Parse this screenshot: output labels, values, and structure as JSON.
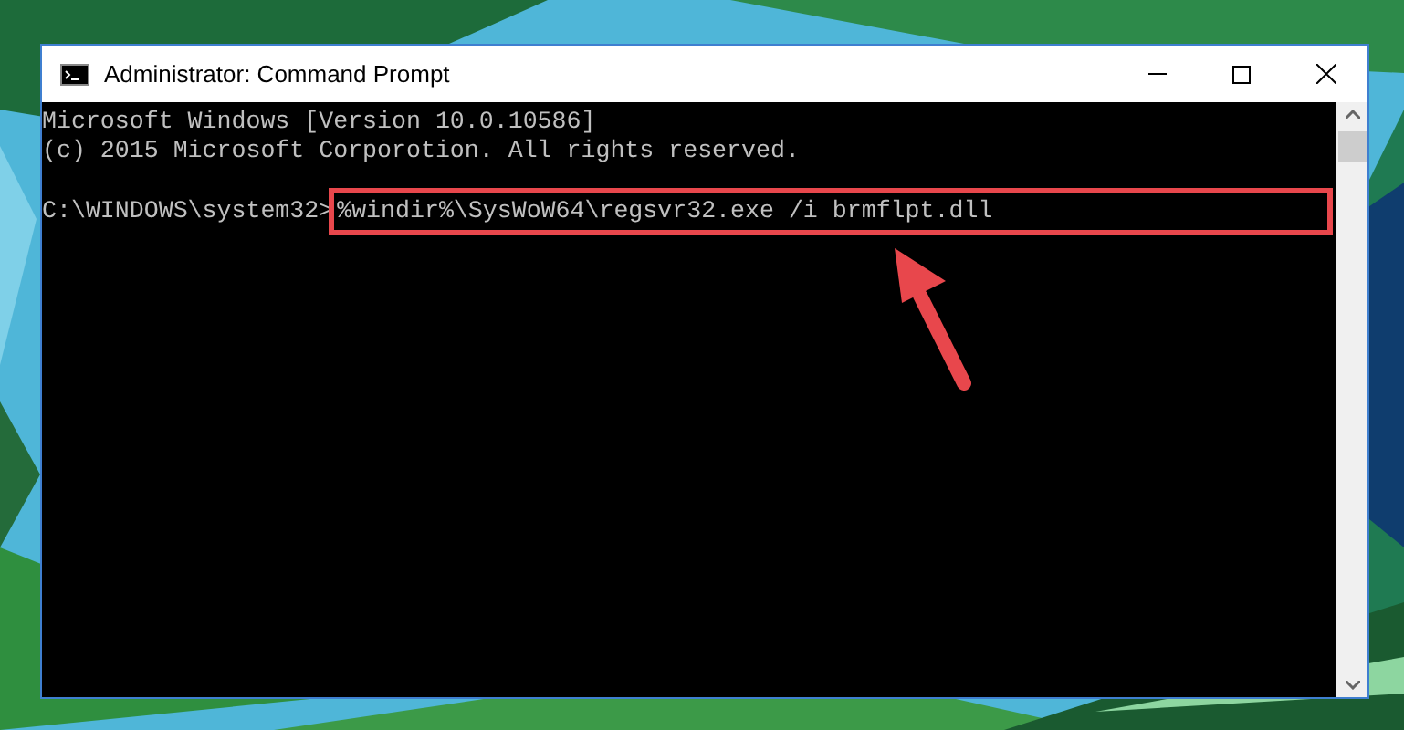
{
  "window": {
    "title": "Administrator: Command Prompt"
  },
  "console": {
    "lines": [
      "Microsoft Windows [Version 10.0.10586]",
      "(c) 2015 Microsoft Corporotion. All rights reserved."
    ],
    "prompt": "C:\\WINDOWS\\system32>",
    "command": "%windir%\\SysWoW64\\regsvr32.exe /i brmflpt.dll",
    "highlighted": true
  }
}
